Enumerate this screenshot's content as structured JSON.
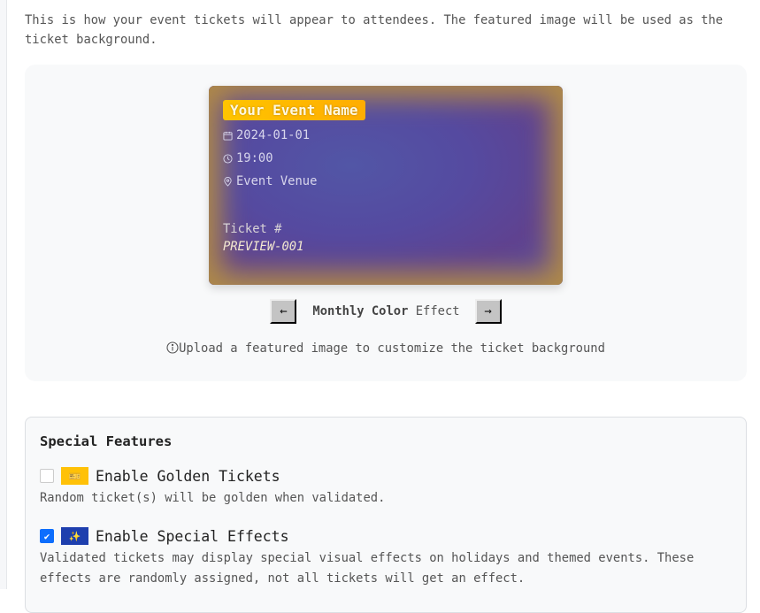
{
  "intro": "This is how your event tickets will appear to attendees. The featured image will be used as the ticket background.",
  "ticket": {
    "event_name": "Your Event Name",
    "date": "2024-01-01",
    "time": "19:00",
    "venue": "Event Venue",
    "ticket_label": "Ticket #",
    "ticket_number": "PREVIEW-001"
  },
  "effect": {
    "name_bold": "Monthly Color",
    "name_rest": "Effect",
    "prev": "←",
    "next": "→"
  },
  "hint": "Upload a featured image to customize the ticket background",
  "features": {
    "title": "Special Features",
    "items": [
      {
        "label": "Enable Golden Tickets",
        "checked": false,
        "icon": "🎫",
        "icon_color": "#ffc107",
        "description": "Random ticket(s) will be golden when validated."
      },
      {
        "label": "Enable Special Effects",
        "checked": true,
        "icon": "✨",
        "icon_color": "#1e3fae",
        "description": "Validated tickets may display special visual effects on holidays and themed events. These effects are randomly assigned, not all tickets will get an effect."
      }
    ]
  }
}
